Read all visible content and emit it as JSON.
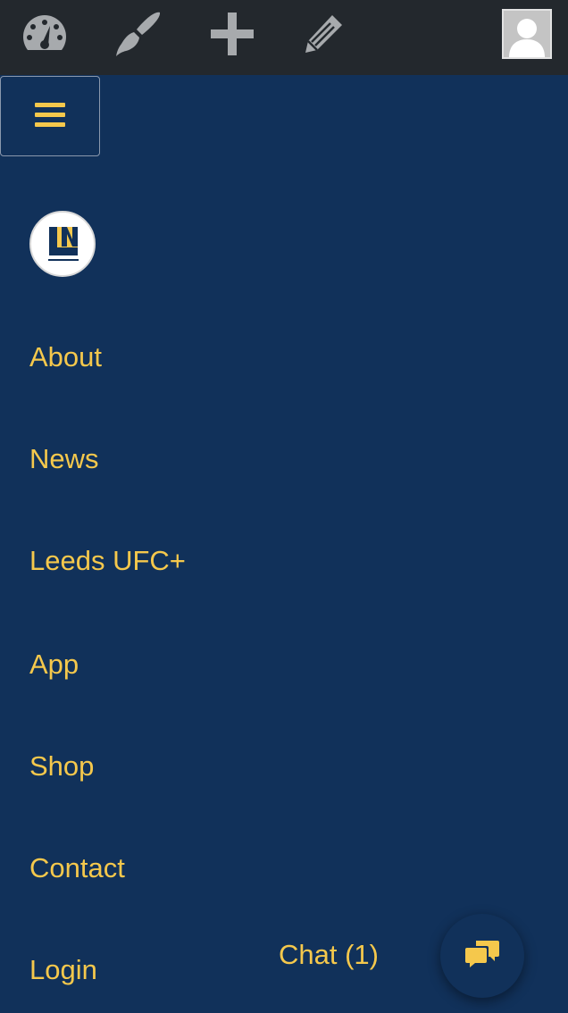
{
  "admin_bar": {
    "icons": [
      "dashboard-icon",
      "paintbrush-icon",
      "plus-icon",
      "pencil-icon"
    ],
    "avatar_icon": "user-avatar-icon",
    "background": "#23282d",
    "icon_color": "#a7aaad"
  },
  "menu_toggle": {
    "icon": "hamburger-icon",
    "border_color": "#8a98ad"
  },
  "logo": {
    "icon": "site-logo"
  },
  "nav": {
    "items": [
      {
        "label": "About"
      },
      {
        "label": "News"
      },
      {
        "label": "Leeds UFC+"
      },
      {
        "label": "App"
      },
      {
        "label": "Shop"
      },
      {
        "label": "Contact"
      },
      {
        "label": "Login"
      }
    ]
  },
  "chat": {
    "label": "Chat (1)",
    "icon": "chat-bubbles-icon"
  },
  "colors": {
    "background": "#11315a",
    "accent": "#f5c84c"
  }
}
